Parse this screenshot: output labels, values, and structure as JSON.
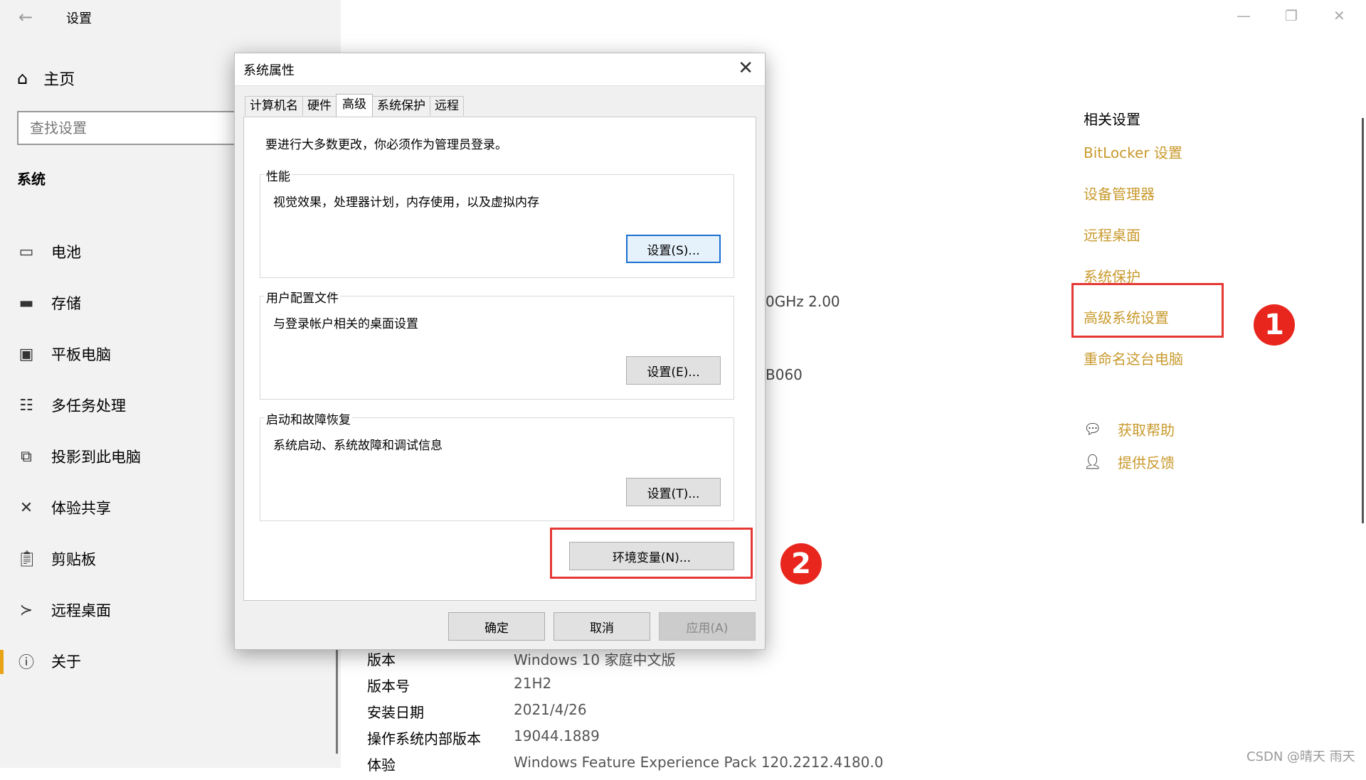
{
  "app": {
    "title": "设置"
  },
  "sidebar": {
    "home_label": "主页",
    "search_placeholder": "查找设置",
    "section_label": "系统",
    "items": [
      {
        "label": "电池",
        "icon": "battery-icon"
      },
      {
        "label": "存储",
        "icon": "storage-icon"
      },
      {
        "label": "平板电脑",
        "icon": "tablet-icon"
      },
      {
        "label": "多任务处理",
        "icon": "multitasking-icon"
      },
      {
        "label": "投影到此电脑",
        "icon": "project-icon"
      },
      {
        "label": "体验共享",
        "icon": "share-icon"
      },
      {
        "label": "剪贴板",
        "icon": "clipboard-icon"
      },
      {
        "label": "远程桌面",
        "icon": "remote-desktop-icon"
      },
      {
        "label": "关于",
        "icon": "info-icon",
        "selected": true
      }
    ]
  },
  "related": {
    "heading": "相关设置",
    "links": [
      "BitLocker 设置",
      "设备管理器",
      "远程桌面",
      "系统保护",
      "高级系统设置",
      "重命名这台电脑"
    ]
  },
  "help": {
    "get_help": "获取帮助",
    "feedback": "提供反馈"
  },
  "main": {
    "partial_cpu": "0GHz   2.00",
    "partial_id": "B060",
    "info": [
      {
        "key": "版本",
        "value": "Windows 10 家庭中文版"
      },
      {
        "key": "版本号",
        "value": "21H2"
      },
      {
        "key": "安装日期",
        "value": "2021/4/26"
      },
      {
        "key": "操作系统内部版本",
        "value": "19044.1889"
      },
      {
        "key": "体验",
        "value": "Windows Feature Experience Pack 120.2212.4180.0"
      }
    ]
  },
  "dialog": {
    "title": "系统属性",
    "tabs": [
      "计算机名",
      "硬件",
      "高级",
      "系统保护",
      "远程"
    ],
    "active_tab": "高级",
    "note": "要进行大多数更改，你必须作为管理员登录。",
    "performance": {
      "title": "性能",
      "desc": "视觉效果，处理器计划，内存使用，以及虚拟内存",
      "button": "设置(S)..."
    },
    "profiles": {
      "title": "用户配置文件",
      "desc": "与登录帐户相关的桌面设置",
      "button": "设置(E)..."
    },
    "startup": {
      "title": "启动和故障恢复",
      "desc": "系统启动、系统故障和调试信息",
      "button": "设置(T)..."
    },
    "env_button": "环境变量(N)...",
    "ok": "确定",
    "cancel": "取消",
    "apply": "应用(A)"
  },
  "annotations": {
    "badge1": "1",
    "badge2": "2"
  },
  "watermark": "CSDN @晴天 雨天",
  "colors": {
    "link": "#c99a2e",
    "highlight": "#e53935",
    "badge": "#e8261d",
    "accent": "#e8a317"
  }
}
